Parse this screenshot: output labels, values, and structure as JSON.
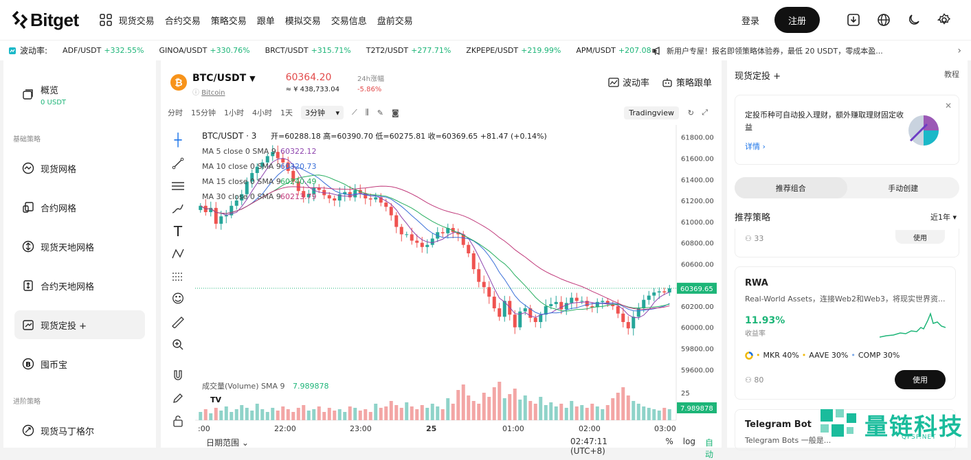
{
  "nav": {
    "logo": "Bitget",
    "items": [
      "现货交易",
      "合约交易",
      "策略交易",
      "跟单",
      "模拟交易",
      "交易信息",
      "盘前交易"
    ],
    "login": "登录",
    "register": "注册"
  },
  "ticker": {
    "label": "波动率:",
    "items": [
      {
        "pair": "ADF/USDT",
        "chg": "+332.55%"
      },
      {
        "pair": "GINOA/USDT",
        "chg": "+330.76%"
      },
      {
        "pair": "BRCT/USDT",
        "chg": "+315.71%"
      },
      {
        "pair": "T2T2/USDT",
        "chg": "+277.71%"
      },
      {
        "pair": "ZKPEPE/USDT",
        "chg": "+219.99%"
      },
      {
        "pair": "APM/USDT",
        "chg": "+207.08"
      }
    ],
    "announcement": "新用户专屋！报名即领策略体验券，最低 20 USDT，零成本盈..."
  },
  "sidebar": {
    "overview": {
      "label": "概览",
      "value": "0 USDT"
    },
    "section_basic": "基础策略",
    "section_advanced": "进阶策略",
    "items": [
      "现货网格",
      "合约网格",
      "现货天地网格",
      "合约天地网格",
      "现货定投 +",
      "囤币宝",
      "现货马丁格尔"
    ]
  },
  "market": {
    "pair": "BTC/USDT",
    "coin_name": "Bitcoin",
    "price": "60364.20",
    "price_cny": "≈ ¥ 438,733.04",
    "change_label": "24h涨幅",
    "change": "-5.86%",
    "volatility": "波动率",
    "follow": "策略跟单"
  },
  "toolbar": {
    "intervals": [
      "分时",
      "15分钟",
      "1小时",
      "4小时",
      "1天"
    ],
    "selected": "3分钟",
    "view": "Tradingview"
  },
  "chart_data": {
    "type": "candlestick",
    "title": "BTC/USDT · 3",
    "ohlc_text": "开=60288.18 高=60390.70 低=60275.81 收=60369.65 +81.47 (+0.14%)",
    "ma_legend": [
      {
        "label": "MA 5 close 0 SMA 9",
        "value": "60322.12",
        "color": "#8e44ad"
      },
      {
        "label": "MA 10 close 0 SMA 9",
        "value": "60320.73",
        "color": "#3a6fd8"
      },
      {
        "label": "MA 15 close 0 SMA 9",
        "value": "60240.49",
        "color": "#27ae60"
      },
      {
        "label": "MA 30 close 0 SMA 9",
        "value": "60213.79",
        "color": "#c0397a"
      }
    ],
    "y_ticks": [
      "61800.00",
      "61600.00",
      "61400.00",
      "61200.00",
      "61000.00",
      "60800.00",
      "60600.00",
      "60400.00",
      "60200.00",
      "60000.00",
      "59800.00",
      "59600.00"
    ],
    "ylim": [
      59550,
      61850
    ],
    "last_price": "60369.65",
    "x_ticks": [
      ":00",
      "22:00",
      "23:00",
      "25",
      "01:00",
      "02:00",
      "03:00"
    ],
    "close_series": [
      61150,
      61090,
      61130,
      60980,
      61050,
      61060,
      61150,
      61200,
      61260,
      61380,
      61460,
      61520,
      61560,
      61620,
      61660,
      61600,
      61560,
      61480,
      61380,
      61290,
      61230,
      61260,
      61320,
      61300,
      61250,
      61220,
      61200,
      61260,
      61280,
      61230,
      61300,
      61270,
      61220,
      61210,
      61230,
      61180,
      61140,
      61060,
      60950,
      60880,
      60880,
      60820,
      60800,
      60760,
      60780,
      60840,
      60900,
      60890,
      60940,
      60900,
      60880,
      60780,
      60700,
      60550,
      60430,
      60380,
      60290,
      60180,
      60100,
      60250,
      60120,
      60000,
      60150,
      60180,
      60090,
      60050,
      60120,
      60200,
      60220,
      60240,
      60170,
      60230,
      60280,
      60250,
      60250,
      60200,
      60190,
      60240,
      60250,
      60220,
      60200,
      60130,
      60050,
      59990,
      60100,
      60180,
      60260,
      60300,
      60330,
      60340,
      60330,
      60369
    ],
    "volume_label": "成交量(Volume) SMA 9",
    "volume_value": "7.989878",
    "volume_axis": "25",
    "volume": [
      6,
      8,
      5,
      9,
      7,
      10,
      6,
      8,
      11,
      9,
      7,
      12,
      8,
      6,
      9,
      7,
      10,
      8,
      6,
      9,
      11,
      7,
      8,
      10,
      6,
      9,
      7,
      8,
      6,
      10,
      9,
      7,
      8,
      6,
      12,
      9,
      10,
      14,
      11,
      9,
      13,
      10,
      8,
      11,
      9,
      12,
      10,
      8,
      16,
      12,
      22,
      26,
      18,
      14,
      12,
      20,
      17,
      24,
      28,
      16,
      19,
      23,
      15,
      18,
      14,
      12,
      17,
      11,
      13,
      10,
      12,
      9,
      14,
      10,
      11,
      9,
      12,
      10,
      8,
      11,
      16,
      20,
      24,
      18,
      14,
      12,
      10,
      9,
      8,
      7,
      9,
      8
    ]
  },
  "chart_footer": {
    "range": "日期范围",
    "time": "02:47:11 (UTC+8)",
    "pct": "%",
    "log": "log",
    "auto": "自动"
  },
  "right": {
    "title": "现货定投 +",
    "tutorial": "教程",
    "promo_text": "定投币种可自动投入理财，额外赚取理财固定收益",
    "promo_link": "详情",
    "tabs": [
      "推荐组合",
      "手动创建"
    ],
    "rec_title": "推荐策略",
    "period": "近1年",
    "prev_count": "33",
    "prev_use": "使用",
    "rwa": {
      "title": "RWA",
      "desc": "Real-World Assets，连接Web2和Web3，将现实世界资...",
      "pct": "11.93%",
      "pct_label": "收益率",
      "alloc": [
        "MKR 40%",
        "AAVE 30%",
        "COMP 30%"
      ],
      "followers": "80",
      "use": "使用"
    },
    "tg": {
      "title": "Telegram Bot",
      "desc": "Telegram Bots 一般是..."
    }
  },
  "watermark": {
    "text": "量链科技",
    "sub": "QFSP.NET"
  }
}
